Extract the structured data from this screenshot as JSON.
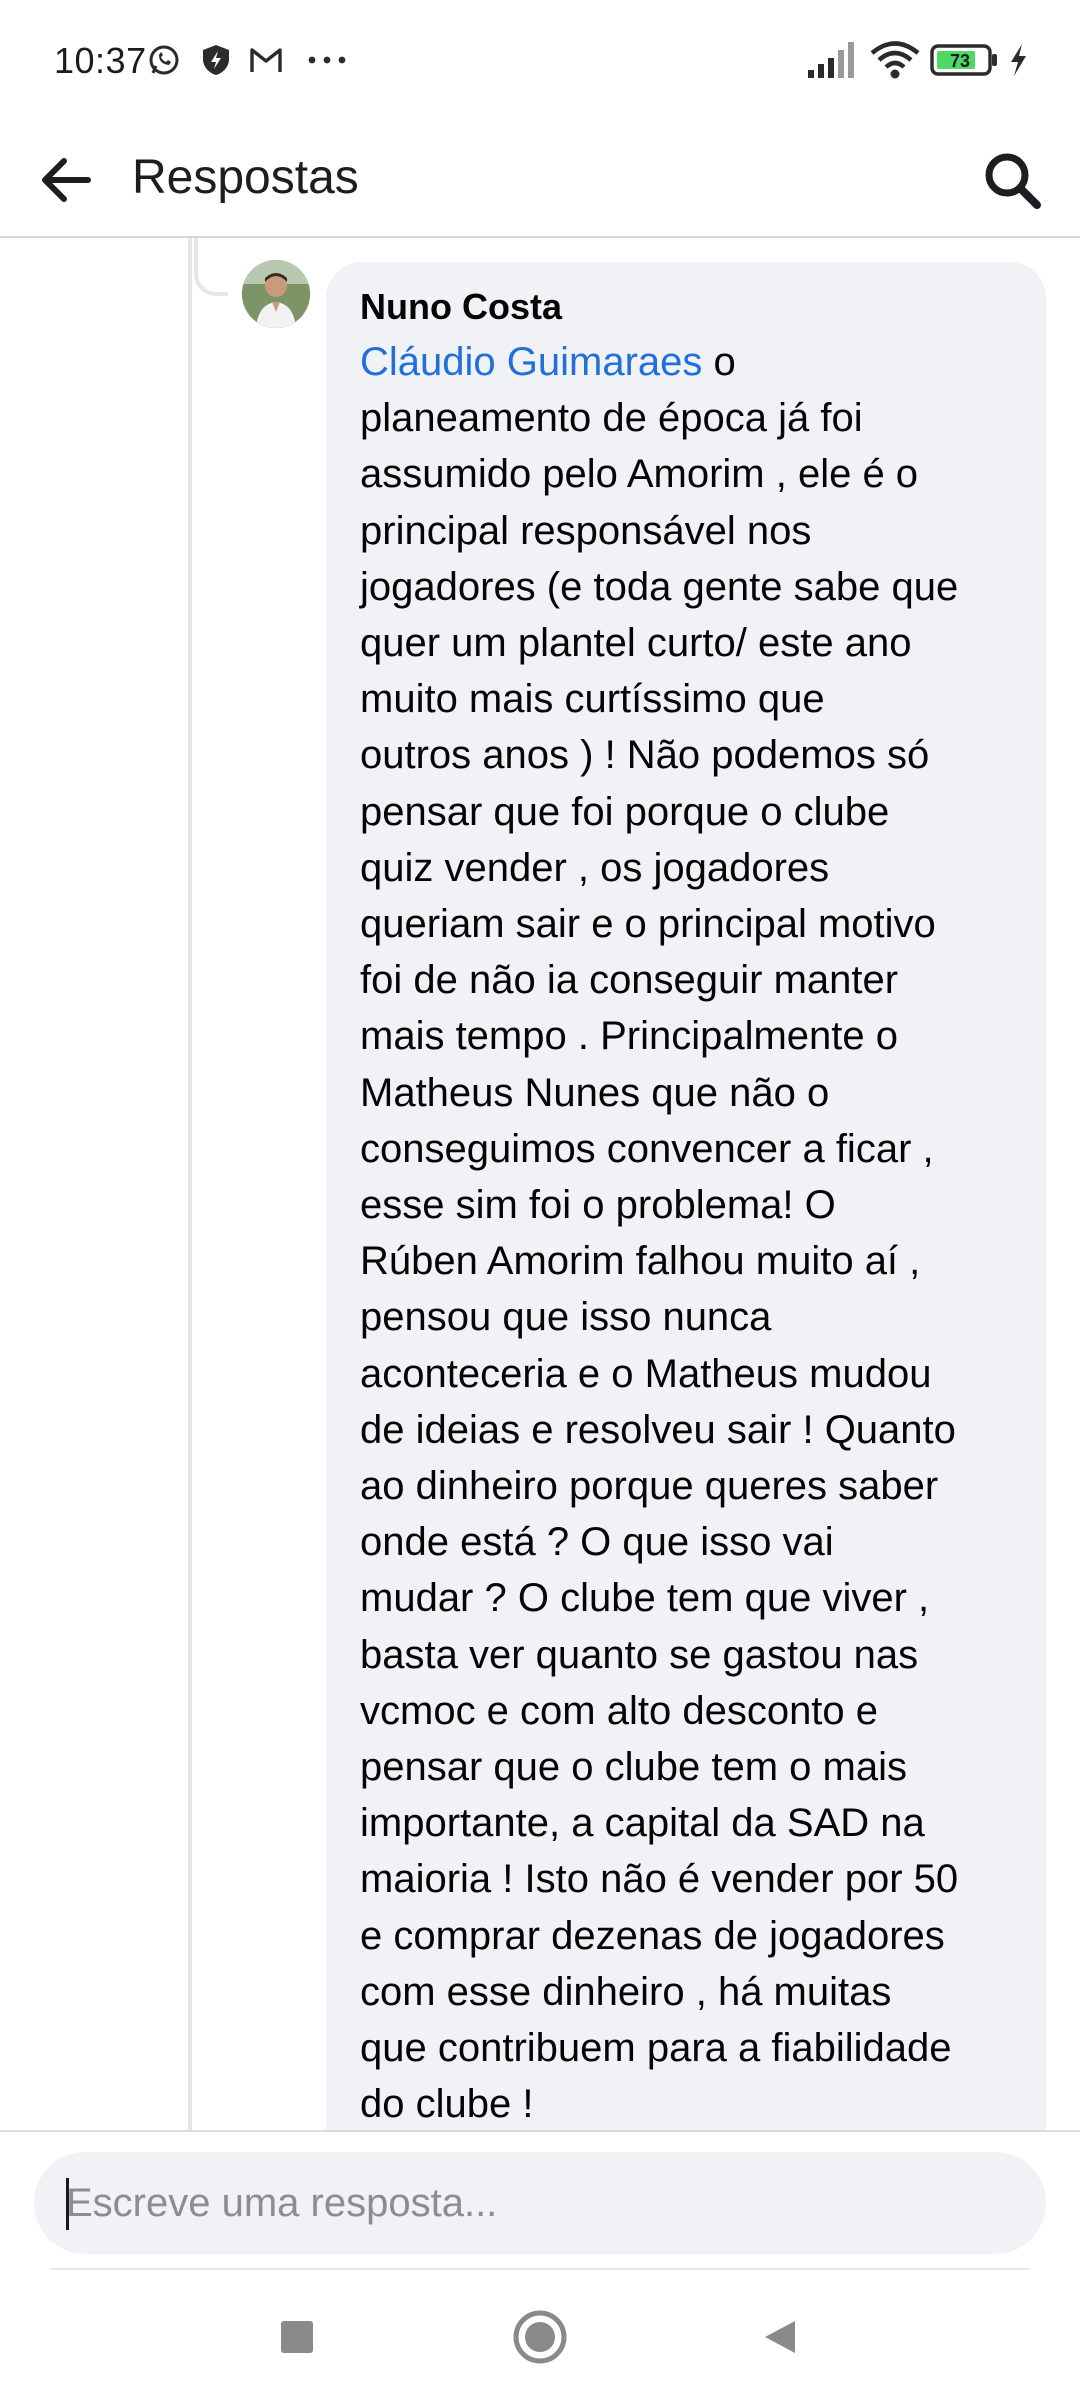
{
  "status_bar": {
    "time": "10:37",
    "battery_level": "73",
    "left_icons": [
      "whatsapp-icon",
      "vpn-shield-icon",
      "gmail-icon",
      "more-dots-icon"
    ],
    "right_icons": [
      "signal-icon",
      "wifi-icon",
      "battery-icon",
      "charging-bolt-icon"
    ]
  },
  "app_bar": {
    "title": "Respostas"
  },
  "comment": {
    "author": "Nuno Costa",
    "mention": "Cláudio Guimaraes",
    "text": " o\nplaneamento de época já foi\nassumido pelo Amorim , ele é o\nprincipal responsável nos\njogadores (e toda gente sabe que\nquer um plantel curto/ este ano\nmuito mais curtíssimo que\noutros anos ) ! Não podemos só\npensar que foi porque o clube\nquiz vender , os jogadores\nqueriam sair e o principal motivo\nfoi de não ia conseguir manter\nmais tempo . Principalmente o\nMatheus Nunes que não o\nconseguimos convencer a ficar ,\nesse sim foi o problema! O\nRúben Amorim falhou muito aí ,\npensou que isso nunca\naconteceria e o Matheus mudou\nde ideias e resolveu sair ! Quanto\nao dinheiro porque queres saber\nonde está ? O que isso vai\nmudar ? O clube tem que viver ,\nbasta ver quanto se gastou nas\nvcmoc e com alto desconto e\npensar que o clube tem o mais\nimportante, a capital da SAD na\nmaioria ! Isto não é vender por 50\ne comprar dezenas de jogadores\ncom esse dinheiro , há muitas\nque contribuem para a fiabilidade\ndo clube !"
  },
  "composer": {
    "placeholder": "Escreve uma resposta...",
    "value": ""
  },
  "nav_bar": {
    "buttons": [
      "recents-square-icon",
      "home-circle-icon",
      "back-triangle-icon"
    ]
  },
  "colors": {
    "mention": "#216fdb",
    "bubble": "#f0f2f5",
    "battery_fill": "#4cd964"
  }
}
